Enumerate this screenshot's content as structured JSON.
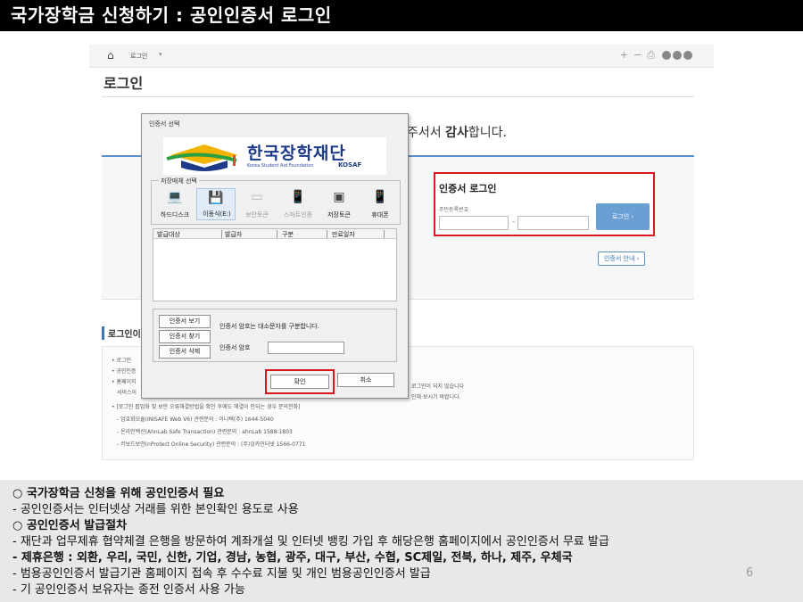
{
  "slide": {
    "title": "국가장학금 신청하기 : 공인인증서 로그인",
    "page_number": "6"
  },
  "browser": {
    "breadcrumb": "로그인",
    "page_heading": "로그인",
    "thanks_prefix": "주서서 ",
    "thanks_bold": "감사",
    "thanks_suffix": "합니다.",
    "login_box": {
      "title": "인증서 로그인",
      "reg_label": "주민등록번호",
      "button": "로그인  ›"
    },
    "guide_button": "인증서 안내 ›",
    "section_title": "로그인이",
    "info_lines": [
      "• 로그인",
      "• 공인인증",
      "• 홈페이지",
      "서비스이",
      "• [로그인 팝업화 및 보안 오류해결방법을 확인 후에도 해결이 안되는 경우 문의전화]",
      "- 암호화모듈(INISAFE Web V6) 관련문의 : 이니텍(주) 1644-5040",
      "- 온라인백신(AhnLab Safe Transaction) 관련문의 : ahnLab 1588-1803",
      "- 키보드보안(nProtect Online Security) 관련문의 : (주)잉카인터넷 1566-0771"
    ],
    "info_right_1": "로그인이 되지 않습니다",
    "info_right_2": "인해 보시기 바랍니다."
  },
  "dialog": {
    "title": "인증서 선택",
    "brand_name": "한국장학재단",
    "brand_sub": "Korea Student Aid Foundation",
    "brand_sub2": "KOSAF",
    "storage_label": "저장매체 선택",
    "media": [
      {
        "label": "하드디스크",
        "icon": "hard-disk-icon",
        "glyph": "💻",
        "disabled": false,
        "selected": false
      },
      {
        "label": "이동식(E:)",
        "icon": "removable-disk-icon",
        "glyph": "💾",
        "disabled": false,
        "selected": true
      },
      {
        "label": "보안토큰",
        "icon": "security-token-icon",
        "glyph": "▭",
        "disabled": true,
        "selected": false
      },
      {
        "label": "스마트인증",
        "icon": "smart-auth-icon",
        "glyph": "📱",
        "disabled": true,
        "selected": false
      },
      {
        "label": "저장토큰",
        "icon": "storage-token-icon",
        "glyph": "▣",
        "disabled": false,
        "selected": false
      },
      {
        "label": "휴대폰",
        "icon": "mobile-phone-icon",
        "glyph": "📱",
        "disabled": false,
        "selected": false
      }
    ],
    "columns": [
      "발급대상",
      "발급자",
      "구분",
      "만료일자"
    ],
    "side_buttons": [
      "인증서 보기",
      "인증서 찾기",
      "인증서 삭제"
    ],
    "pwd_note": "인증서 암호는 대소문자를 구분합니다.",
    "pwd_label": "인증서 암호",
    "ok": "확인",
    "cancel": "취소"
  },
  "notes": [
    {
      "text": "○ 국가장학금 신청을 위해 공인인증서 필요",
      "bold": true
    },
    {
      "text": "  - 공인인증서는 인터넷상 거래를 위한 본인확인 용도로 사용",
      "bold": false
    },
    {
      "text": "○ 공인인증서 발급절차",
      "bold": true
    },
    {
      "text": "  - 재단과 업무제휴 협약체결 은행을 방문하여 계좌개설 및 인터넷 뱅킹 가입 후 해당은행 홈페이지에서 공인인증서 무료 발급",
      "bold": false
    },
    {
      "text": "  - 제휴은행 : 외환, 우리, 국민, 신한, 기업, 경남, 농협, 광주, 대구, 부산, 수협, SC제일, 전북, 하나, 제주, 우체국",
      "bold": true
    },
    {
      "text": "  - 범용공인인증서 발급기관 홈페이지 접속 후 수수료 지불 및 개인 범용공인인증서 발급",
      "bold": false
    },
    {
      "text": "  - 기 공인인증서 보유자는 종전 인증서 사용 가능",
      "bold": false
    }
  ]
}
